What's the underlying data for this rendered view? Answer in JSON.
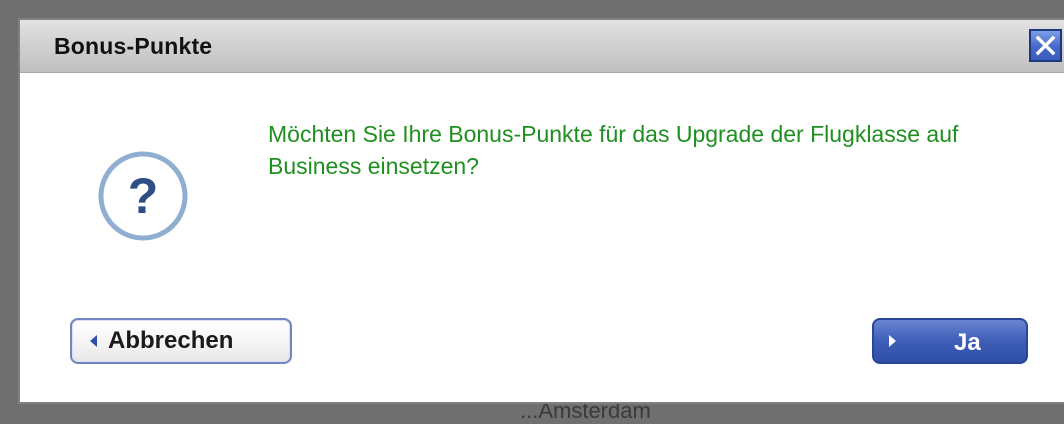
{
  "dialog": {
    "title": "Bonus-Punkte",
    "message": "Möchten Sie Ihre Bonus-Punkte für das Upgrade der Flugklasse auf Business einsetzen?",
    "question_icon_glyph": "?",
    "icons": {
      "close": "close-icon",
      "question": "question-icon",
      "back": "arrow-left-icon",
      "forward": "arrow-right-icon"
    },
    "buttons": {
      "cancel_label": "Abbrechen",
      "confirm_label": "Ja"
    }
  },
  "backdrop": {
    "partial_text": "...Amsterdam"
  },
  "colors": {
    "message_text": "#1f8f1f",
    "accent_blue": "#3e5eb8",
    "icon_ring": "#8faed0",
    "icon_glyph": "#2e4f86"
  }
}
